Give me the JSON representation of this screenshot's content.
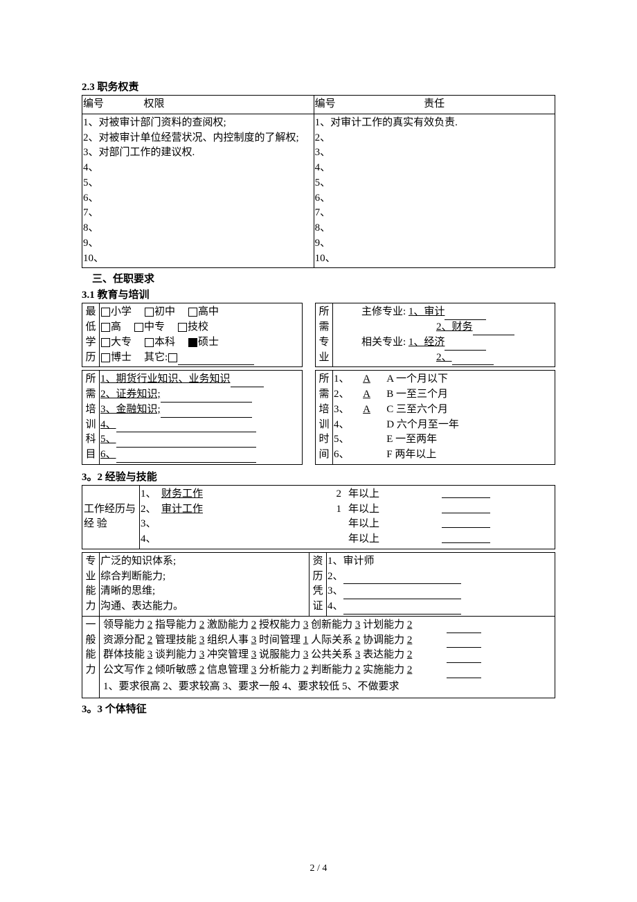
{
  "sec23": {
    "title": "2.3 职务权责",
    "left_h1": "编号",
    "left_h2": "权限",
    "right_h1": "编号",
    "right_h2": "责任",
    "left_items": [
      "1、对被审计部门资料的查阅权;",
      "2、对被审计单位经营状况、内控制度的了解权;",
      "3、对部门工作的建议权.",
      "4、",
      "5、",
      "6、",
      "7、",
      "8、",
      "9、",
      "10、"
    ],
    "right_items": [
      "1、对审计工作的真实有效负责.",
      "2、",
      "3、",
      "4、",
      "5、",
      "6、",
      "7、",
      "8、",
      "9、",
      "10、"
    ]
  },
  "sec3": {
    "title": "三、任职要求"
  },
  "sec31": {
    "title": "3.1 教育与培训",
    "edu_label": "最低学历",
    "edu_row1": [
      "小学",
      "初中",
      "高中"
    ],
    "edu_row2": [
      "高",
      "中专",
      "技校"
    ],
    "edu_row3": [
      "大专",
      "本科",
      "硕士"
    ],
    "edu_row4": [
      "博士",
      "其它:"
    ],
    "major_label": "所需专业",
    "major_main_label": "主修专业:",
    "major_main_1": "1、审计",
    "major_main_2": "2、财务",
    "major_rel_label": "相关专业:",
    "major_rel_1": "1、经济",
    "major_rel_2": "2、",
    "train_label": "所需培训科目",
    "train_items": [
      "1、期货行业知识、业务知识",
      "2、证券知识;",
      "3、金融知识;",
      "4、",
      "5、",
      "6、"
    ],
    "time_label": "所需培训时间",
    "time_items": [
      {
        "n": "1、",
        "sel": "A",
        "txt": "A 一个月以下"
      },
      {
        "n": "2、",
        "sel": "A",
        "txt": "B 一至三个月"
      },
      {
        "n": "3、",
        "sel": "A",
        "txt": "C 三至六个月"
      },
      {
        "n": "4、",
        "sel": "",
        "txt": "D 六个月至一年"
      },
      {
        "n": "5、",
        "sel": "",
        "txt": "E 一至两年"
      },
      {
        "n": "6、",
        "sel": "",
        "txt": "F 两年以上"
      }
    ]
  },
  "sec32": {
    "title": "3。2 经验与技能",
    "work_label": "工作经历与 经 验",
    "work_rows": [
      {
        "n": "1、",
        "name": "财务工作",
        "yrs": "2",
        "suf": "年以上"
      },
      {
        "n": "2、",
        "name": "审计工作",
        "yrs": "1",
        "suf": "年以上"
      },
      {
        "n": "3、",
        "name": "",
        "yrs": "",
        "suf": "年以上"
      },
      {
        "n": "4、",
        "name": "",
        "yrs": "",
        "suf": "年以上"
      }
    ],
    "pro_label": "专业能力",
    "pro_items": [
      "广泛的知识体系;",
      "综合判断能力;",
      "清晰的思维;",
      "沟通、表达能力。"
    ],
    "cert_label": "资历凭证",
    "cert_items": [
      "1、审计师",
      "2、",
      "3、",
      "4、"
    ],
    "gen_label": "一般能力",
    "gen_rows": [
      [
        [
          "领导能力",
          "2"
        ],
        [
          "指导能力",
          "2"
        ],
        [
          "激励能力",
          "2"
        ],
        [
          "授权能力",
          "3"
        ],
        [
          "创新能力",
          "3"
        ],
        [
          "计划能力",
          "2"
        ]
      ],
      [
        [
          "资源分配",
          "2"
        ],
        [
          "管理技能",
          "3"
        ],
        [
          "组织人事",
          "3"
        ],
        [
          "时间管理",
          "1"
        ],
        [
          "人际关系",
          "2"
        ],
        [
          "协调能力",
          "2"
        ]
      ],
      [
        [
          "群体技能",
          "3"
        ],
        [
          "谈判能力",
          "3"
        ],
        [
          "冲突管理",
          "3"
        ],
        [
          "说服能力",
          "3"
        ],
        [
          "公共关系",
          "3"
        ],
        [
          "表达能力",
          "2"
        ]
      ],
      [
        [
          "公文写作",
          "2"
        ],
        [
          "倾听敏感",
          "2"
        ],
        [
          "信息管理",
          "3"
        ],
        [
          "分析能力",
          "2"
        ],
        [
          "判断能力",
          "2"
        ],
        [
          "实施能力",
          "2"
        ]
      ]
    ],
    "scale": "1、要求很高  2、要求较高   3、要求一般   4、要求较低   5、不做要求"
  },
  "sec33": {
    "title": "3。3 个体特征"
  },
  "footer": "2 / 4"
}
